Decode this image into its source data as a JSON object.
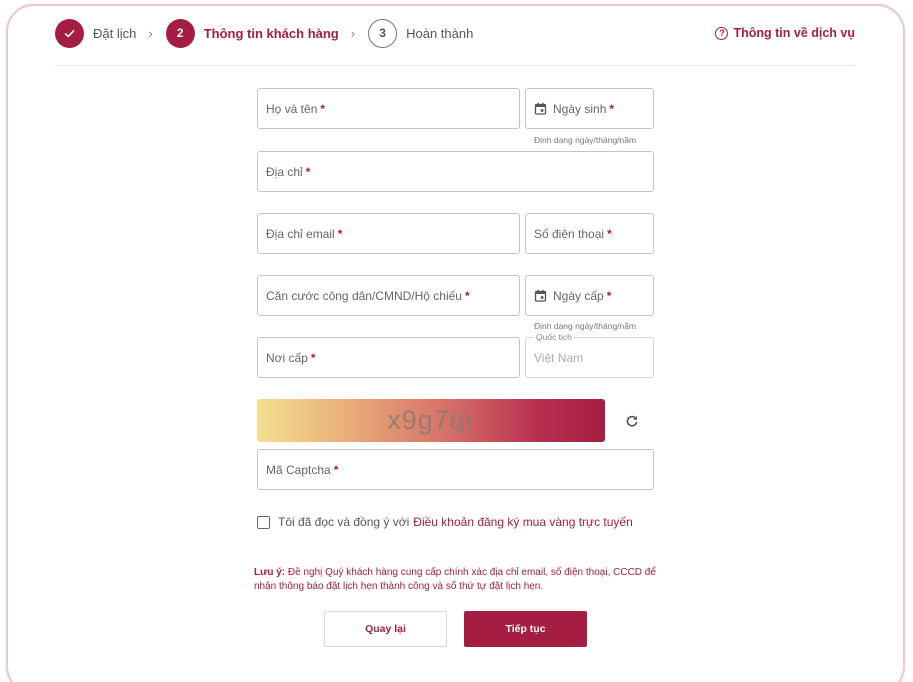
{
  "stepper": {
    "steps": [
      {
        "number": "",
        "label": "Đặt lịch",
        "state": "done"
      },
      {
        "number": "2",
        "label": "Thông tin khách hàng",
        "state": "active"
      },
      {
        "number": "3",
        "label": "Hoàn thành",
        "state": "todo"
      }
    ],
    "separator": "›"
  },
  "help": {
    "label": "Thông tin về dịch vụ",
    "icon": "help-circle-icon",
    "glyph": "?"
  },
  "form": {
    "required_mark": "*",
    "full_name": {
      "label": "Họ và tên"
    },
    "dob": {
      "label": "Ngày sinh",
      "icon": "calendar-icon",
      "hint": "Định dạng ngày/tháng/năm"
    },
    "address": {
      "label": "Địa chỉ"
    },
    "email": {
      "label": "Địa chỉ email"
    },
    "phone": {
      "label": "Số điện thoại"
    },
    "id_number": {
      "label": "Căn cước công dân/CMND/Hộ chiếu"
    },
    "issue_date": {
      "label": "Ngày cấp",
      "icon": "calendar-icon",
      "hint": "Định dạng ngày/tháng/năm"
    },
    "issue_place": {
      "label": "Nơi cấp"
    },
    "nationality": {
      "legend": "Quốc tịch",
      "value": "Việt Nam"
    },
    "captcha": {
      "text": "x9g7qi",
      "refresh_icon": "refresh-icon"
    },
    "captcha_input": {
      "label": "Mã Captcha"
    },
    "agree": {
      "text": "Tôi đã đọc và đồng ý với",
      "link": "Điều khoản đăng ký mua vàng trực tuyến",
      "checked": false
    }
  },
  "note": {
    "title": "Lưu ý:",
    "text": "Đề nghị Quý khách hàng cung cấp chính xác địa chỉ email, số điện thoại, CCCD để nhận thông báo đặt lịch hẹn thành công và số thứ tự đặt lịch hẹn."
  },
  "buttons": {
    "back": "Quay lại",
    "next": "Tiếp tục"
  },
  "colors": {
    "accent": "#a51d42",
    "border": "#c4c4c4"
  }
}
